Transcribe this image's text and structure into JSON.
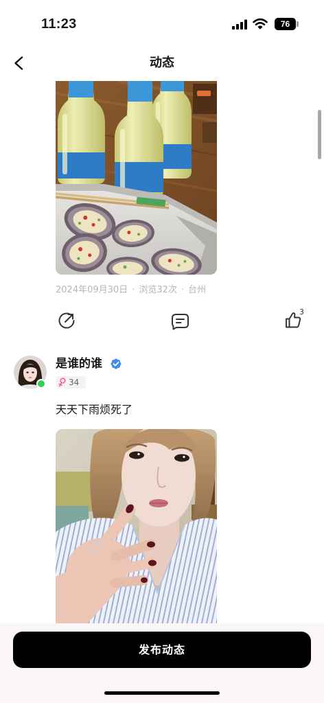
{
  "status_bar": {
    "time": "11:23",
    "battery_level": "76",
    "icons": [
      "signal-icon",
      "wifi-icon",
      "battery-icon"
    ]
  },
  "nav": {
    "title": "动态",
    "back_icon": "chevron-left-icon"
  },
  "posts": [
    {
      "meta": {
        "date": "2024年09月30日",
        "separator": "·",
        "views": "浏览32次",
        "location": "台州"
      },
      "actions": {
        "share_icon": "share-icon",
        "comment_icon": "comment-icon",
        "like_icon": "thumbs-up-icon",
        "like_count": "3"
      }
    },
    {
      "author": {
        "name": "是谁的谁",
        "verified": true,
        "verified_icon": "verified-badge-icon",
        "online": true,
        "gender_icon": "female-icon",
        "age": "34"
      },
      "text": "天天下雨烦死了"
    }
  ],
  "publish_button": {
    "label": "发布动态"
  },
  "colors": {
    "background": "#ffffff",
    "text_primary": "#1a1a1a",
    "text_meta": "#b5b5b5",
    "button_bg": "#000000",
    "button_text": "#ffffff",
    "verified": "#3f8cf1",
    "online": "#2fcf5a",
    "female": "#ff5c8d"
  }
}
